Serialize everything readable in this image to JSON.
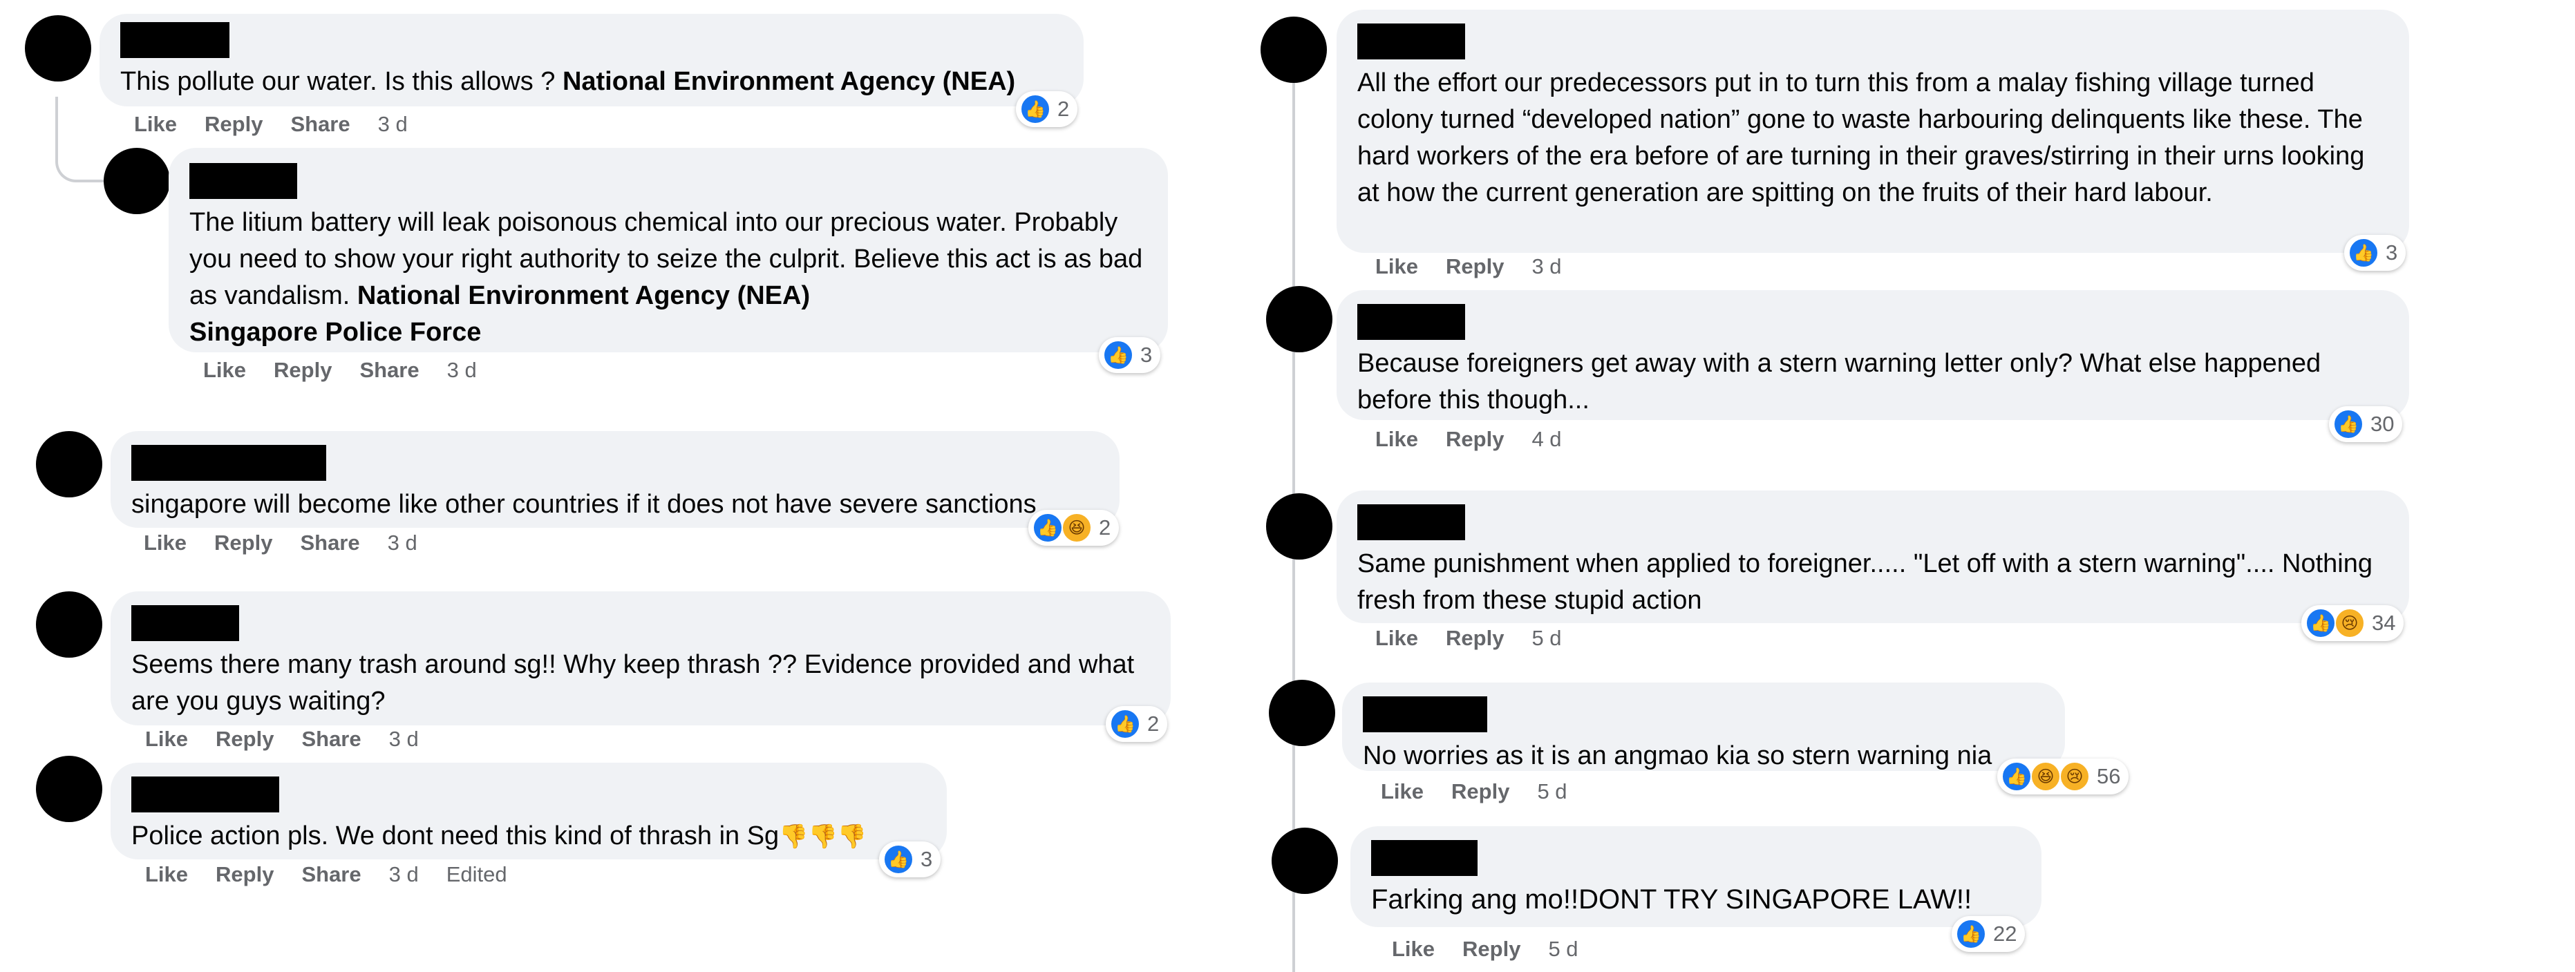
{
  "left": [
    {
      "text_parts": [
        "This pollute our water. Is this allows ? "
      ],
      "mentions": [
        "National Environment Agency (NEA)"
      ],
      "actions": {
        "like": "Like",
        "reply": "Reply",
        "share": "Share",
        "time": "3 d"
      },
      "reactions": {
        "count": "2"
      }
    },
    {
      "text_parts": [
        "The litium battery will leak poisonous chemical into our precious water. Probably you need to show your right authority to seize the culprit. Believe this act is as bad as vandalism. "
      ],
      "mentions": [
        "National Environment Agency (NEA)",
        "Singapore Police Force"
      ],
      "actions": {
        "like": "Like",
        "reply": "Reply",
        "share": "Share",
        "time": "3 d"
      },
      "reactions": {
        "count": "3"
      }
    },
    {
      "text_parts": [
        "singapore will become like other countries if it does not have severe sanctions"
      ],
      "actions": {
        "like": "Like",
        "reply": "Reply",
        "share": "Share",
        "time": "3 d"
      },
      "reactions": {
        "count": "2"
      }
    },
    {
      "text_parts": [
        "Seems there many trash around sg!! Why keep thrash ?? Evidence provided and what are you guys waiting?"
      ],
      "actions": {
        "like": "Like",
        "reply": "Reply",
        "share": "Share",
        "time": "3 d"
      },
      "reactions": {
        "count": "2"
      }
    },
    {
      "text_parts": [
        "Police action pls. We dont need this kind of thrash in Sg"
      ],
      "emoji": "👎👎👎",
      "actions": {
        "like": "Like",
        "reply": "Reply",
        "share": "Share",
        "time": "3 d",
        "edited": "Edited"
      },
      "reactions": {
        "count": "3"
      }
    }
  ],
  "right": [
    {
      "text_parts": [
        "All the effort our predecessors put in to turn this from a malay fishing village turned colony turned “developed nation” gone to waste harbouring delinquents like these. The hard workers of the era before of are turning in their graves/stirring in their urns looking at how the current generation are spitting on the fruits of their hard labour."
      ],
      "actions": {
        "like": "Like",
        "reply": "Reply",
        "time": "3 d"
      },
      "reactions": {
        "count": "3"
      }
    },
    {
      "text_parts": [
        "Because foreigners get away with a stern warning letter only? What else happened before this though..."
      ],
      "actions": {
        "like": "Like",
        "reply": "Reply",
        "time": "4 d"
      },
      "reactions": {
        "count": "30"
      }
    },
    {
      "text_parts": [
        "Same punishment when applied to foreigner..... \"Let off with a stern warning\".... Nothing fresh from these stupid action"
      ],
      "actions": {
        "like": "Like",
        "reply": "Reply",
        "time": "5 d"
      },
      "reactions": {
        "count": "34"
      }
    },
    {
      "text_parts": [
        "No worries as it is an angmao kia so stern warning nia"
      ],
      "actions": {
        "like": "Like",
        "reply": "Reply",
        "time": "5 d"
      },
      "reactions": {
        "count": "56"
      }
    },
    {
      "text_parts": [
        "Farking ang mo!!DONT TRY SINGAPORE LAW!!"
      ],
      "actions": {
        "like": "Like",
        "reply": "Reply",
        "time": "5 d"
      },
      "reactions": {
        "count": "22"
      }
    }
  ],
  "icons": {
    "like": "like-icon",
    "haha": "haha-icon",
    "sad": "sad-icon"
  },
  "colors": {
    "bubble": "#f0f2f5",
    "like_blue": "#1877f2",
    "meta_gray": "#65676b"
  }
}
